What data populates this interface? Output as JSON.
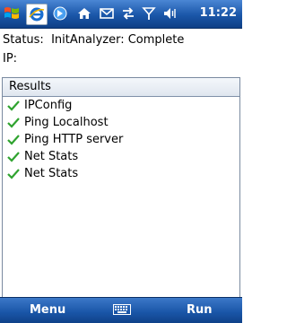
{
  "statusbar": {
    "time": "11:22",
    "icons": [
      "start-icon",
      "ie-icon",
      "arrow-icon",
      "home-icon",
      "mail-icon",
      "connectivity-icon",
      "signal-icon",
      "volume-icon"
    ]
  },
  "status": {
    "label": "Status:",
    "value": "InitAnalyzer: Complete"
  },
  "ip": {
    "label": "IP:",
    "value": ""
  },
  "results": {
    "header": "Results",
    "items": [
      {
        "label": "IPConfig"
      },
      {
        "label": "Ping Localhost"
      },
      {
        "label": "Ping HTTP server"
      },
      {
        "label": "Net Stats"
      },
      {
        "label": "Net Stats"
      }
    ]
  },
  "softkeys": {
    "left": "Menu",
    "right": "Run",
    "keyboard_icon": "keyboard-icon"
  },
  "colors": {
    "bar": "#1a56a8",
    "check": "#2fa32f"
  }
}
